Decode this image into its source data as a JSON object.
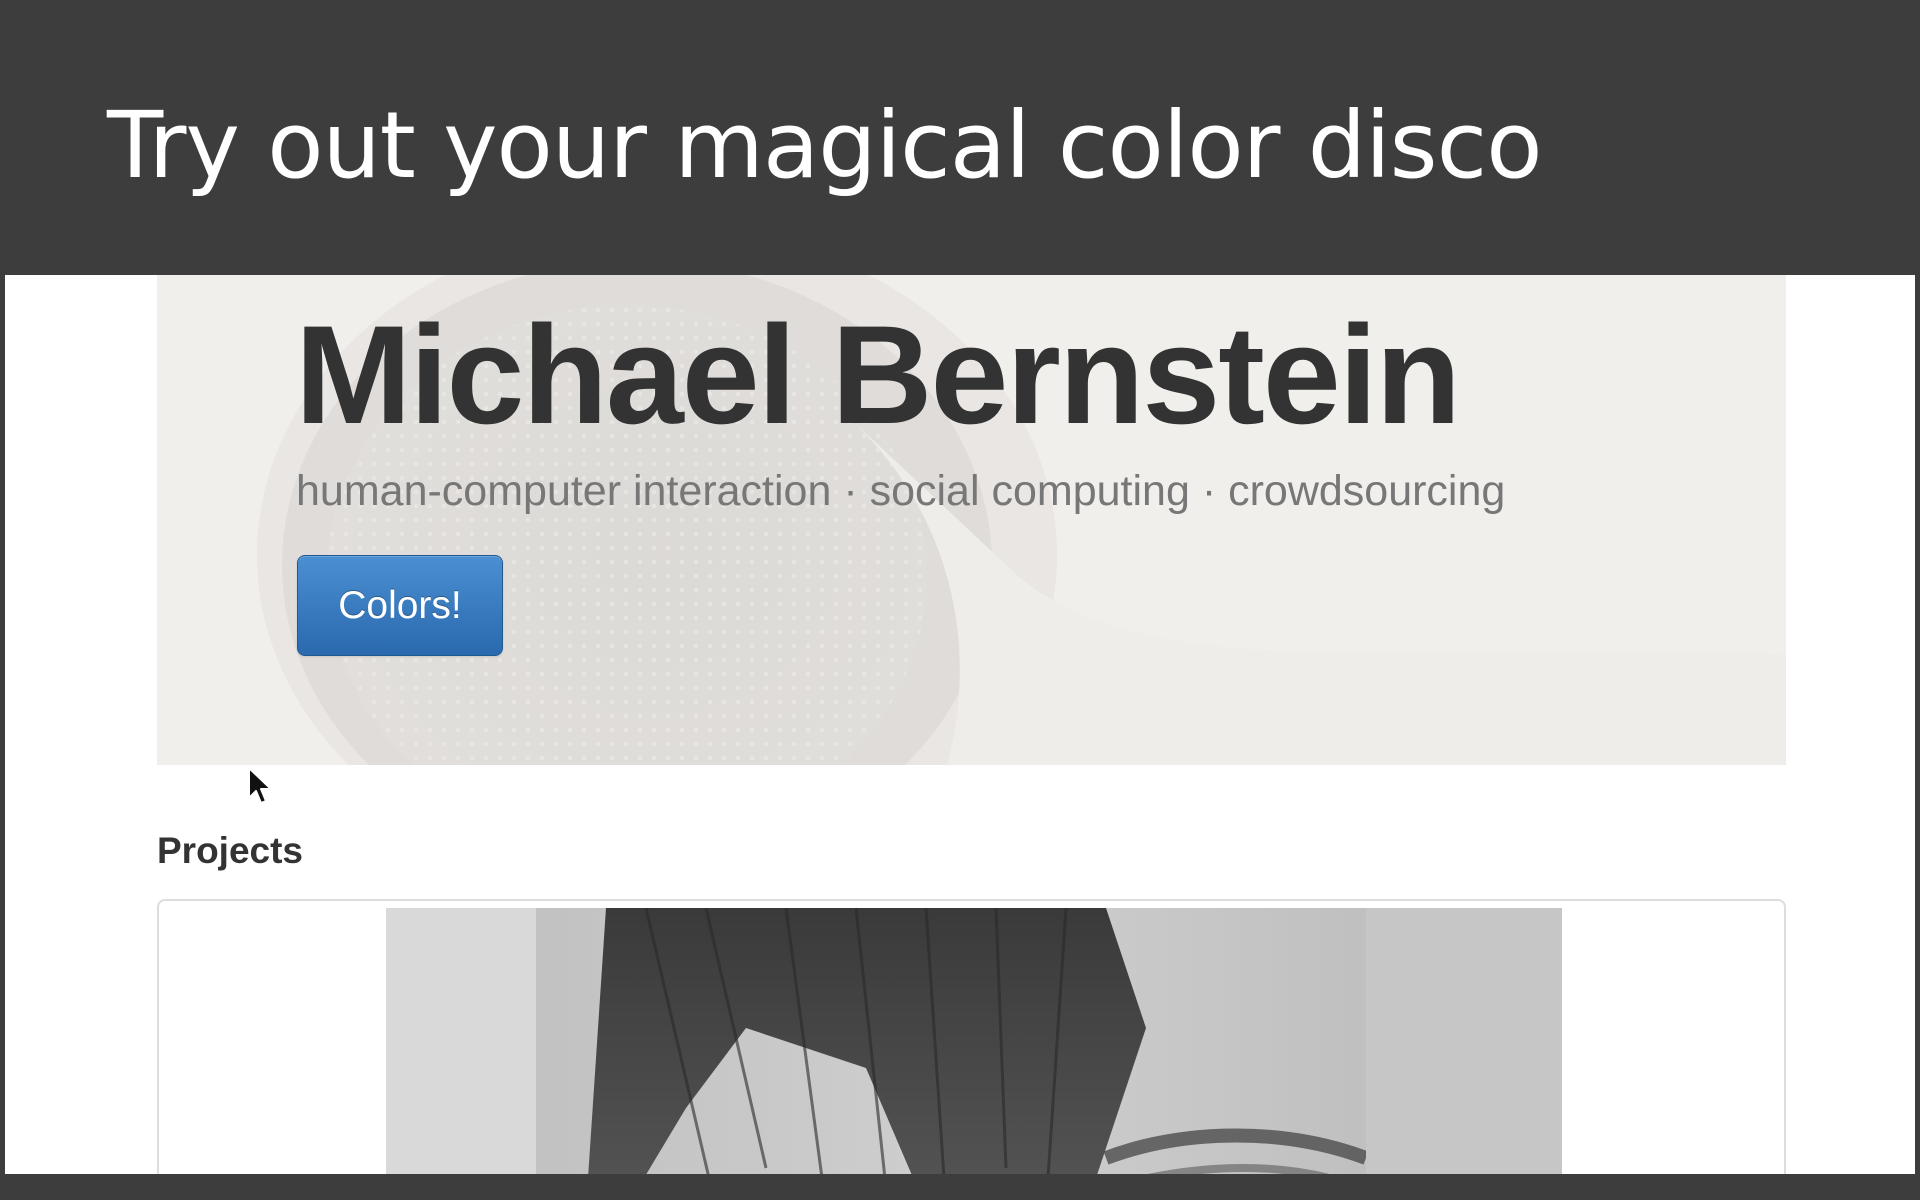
{
  "slide": {
    "title": "Try out your magical color disco"
  },
  "hero": {
    "name": "Michael Bernstein",
    "tagline": "human-computer interaction · social computing · crowdsourcing",
    "button_label": "Colors!"
  },
  "projects": {
    "heading": "Projects"
  },
  "colors": {
    "slide_background": "#3d3d3d",
    "button_blue": "#2a69ad",
    "name_text": "#333333",
    "tagline_text": "#777777"
  },
  "icons": {
    "cursor": "mouse-pointer-icon"
  }
}
